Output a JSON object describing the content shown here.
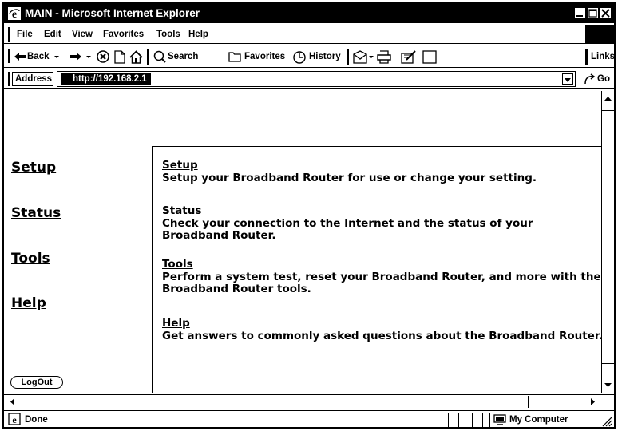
{
  "window": {
    "title": "MAIN - Microsoft Internet Explorer"
  },
  "menu": {
    "items": [
      "File",
      "Edit",
      "View",
      "Favorites",
      "Tools",
      "Help"
    ]
  },
  "toolbar": {
    "back_label": "Back",
    "search_label": "Search",
    "favorites_label": "Favorites",
    "history_label": "History",
    "links_label": "Links",
    "icons": [
      "back-arrow-icon",
      "forward-arrow-icon",
      "stop-icon",
      "refresh-icon",
      "home-icon",
      "search-icon",
      "favorites-folder-icon",
      "history-icon",
      "mail-icon",
      "print-icon",
      "edit-icon",
      "discuss-icon"
    ]
  },
  "address": {
    "label": "Address",
    "url": "http://192.168.2.1",
    "go_label": "Go"
  },
  "sidebar": {
    "links": [
      "Setup",
      "Status",
      "Tools",
      "Help"
    ],
    "logout_label": "LogOut"
  },
  "main": {
    "sections": [
      {
        "title": "Setup",
        "lines": [
          "Setup your Broadband Router for use or change your setting."
        ]
      },
      {
        "title": "Status",
        "lines": [
          "Check your connection to the Internet and the status of your",
          "Broadband Router."
        ]
      },
      {
        "title": "Tools",
        "lines": [
          "Perform a system test, reset your Broadband Router, and more with the",
          "Broadband Router tools."
        ]
      },
      {
        "title": "Help",
        "lines": [
          "Get answers to commonly asked questions about the Broadband Router."
        ]
      }
    ]
  },
  "status": {
    "text": "Done",
    "zone": "My Computer"
  }
}
